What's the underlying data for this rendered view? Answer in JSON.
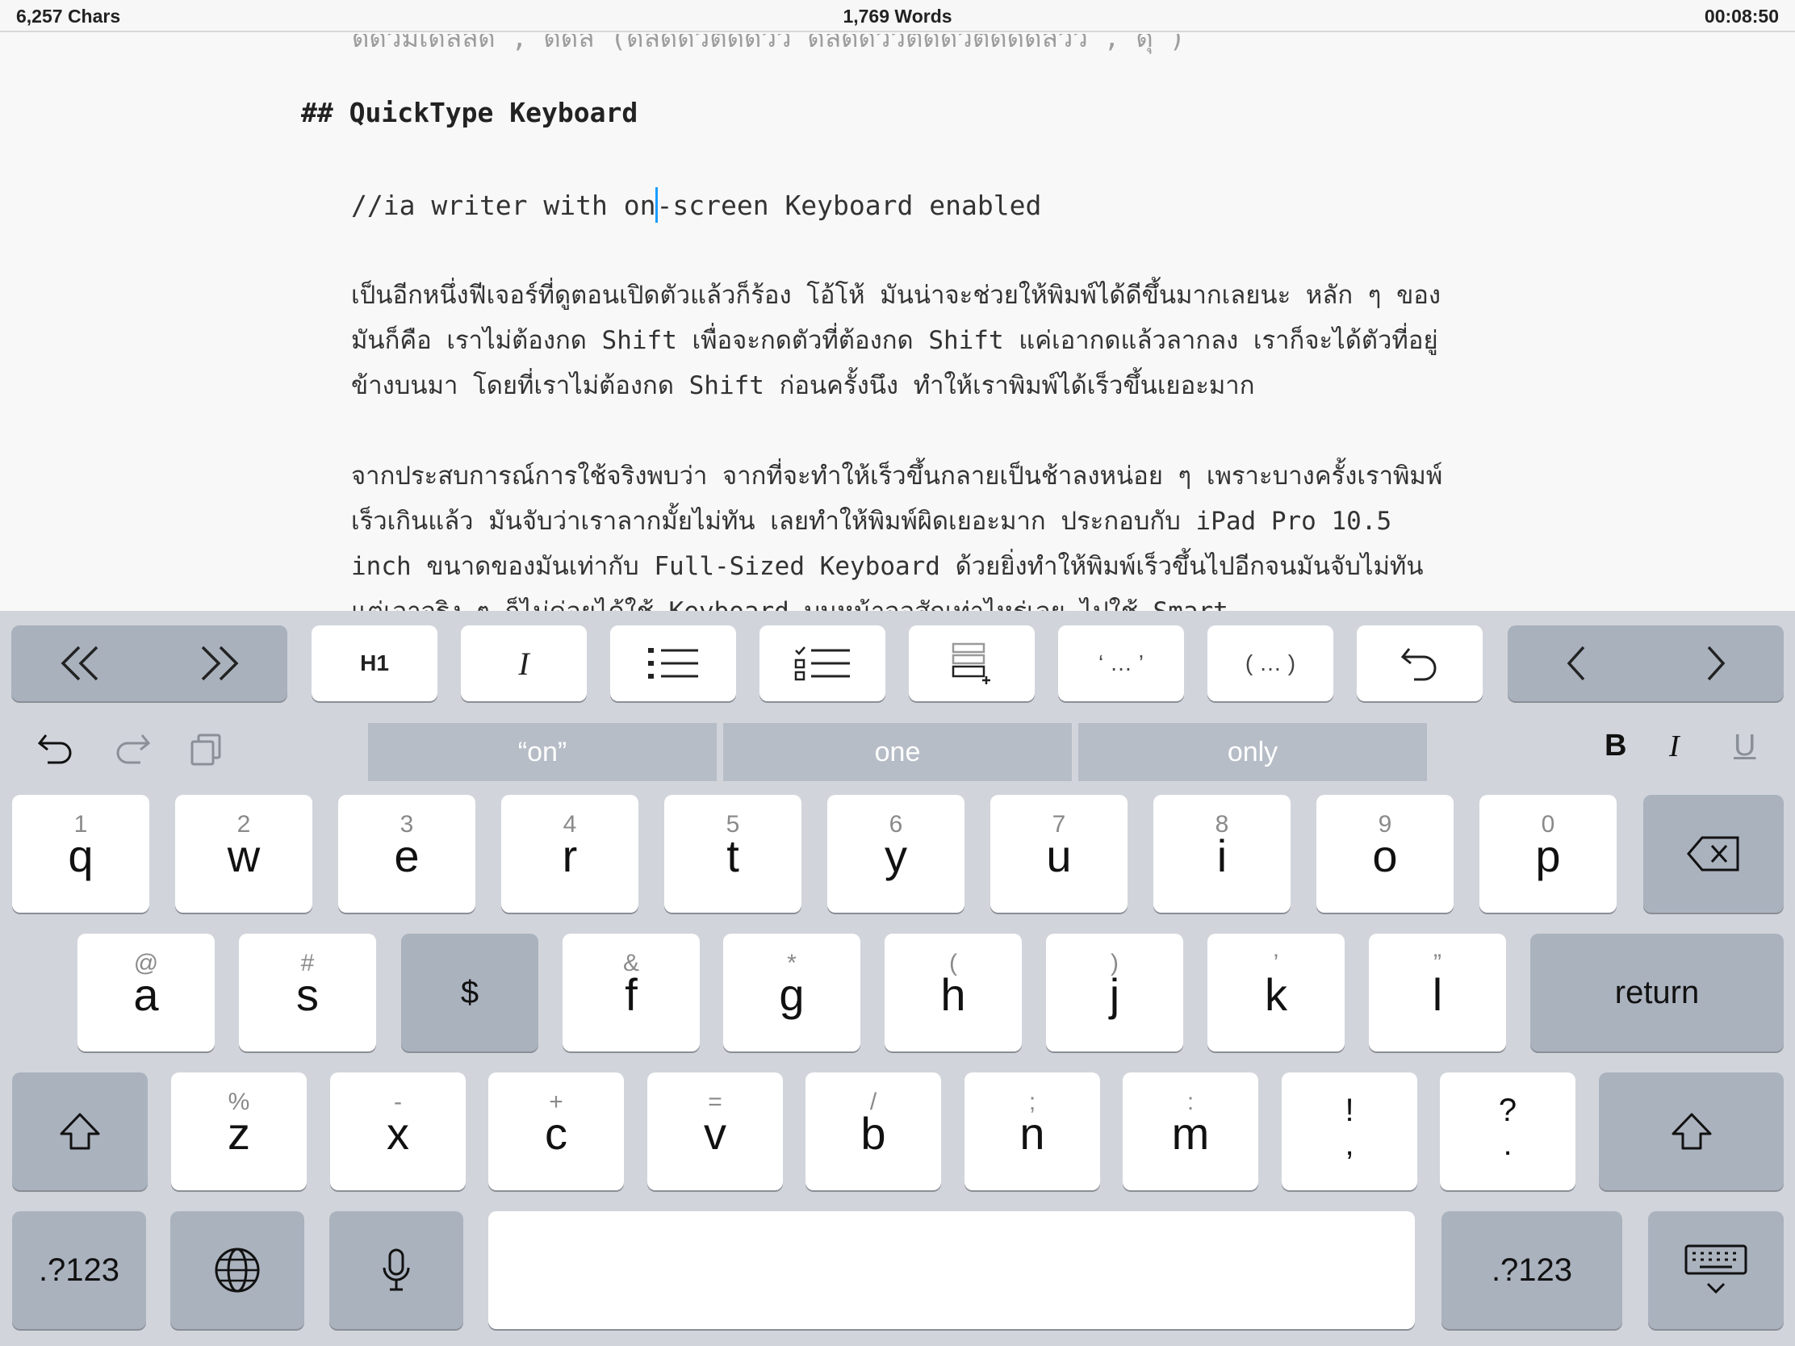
{
  "status": {
    "chars": "6,257 Chars",
    "words": "1,769 Words",
    "timer": "00:08:50"
  },
  "editor": {
    "faded_line": "ดดวิมิเดลลด , ดดลิ (ดลดดวิตดดวว ดลดดววิตดดวิตดดดลวว , ดุ )",
    "heading": "## QuickType Keyboard",
    "comment_before_cursor": "//ia writer with on",
    "comment_after_cursor": "-screen Keyboard enabled",
    "paragraph1": "เป็นอีกหนึ่งฟีเจอร์ที่ดูตอนเปิดตัวแล้วก็ร้อง โอ้โห้ มันน่าจะช่วยให้พิมพ์ได้ดีขึ้นมากเลยนะ หลัก ๆ ของมันก็คือ เราไม่ต้องกด Shift เพื่อจะกดตัวที่ต้องกด Shift แค่เอากดแล้วลากลง เราก็จะได้ตัวที่อยู่ข้างบนมา โดยที่เราไม่ต้องกด Shift ก่อนครั้งนึง ทำให้เราพิมพ์ได้เร็วขึ้นเยอะมาก",
    "paragraph2": "จากประสบการณ์การใช้จริงพบว่า จากที่จะทำให้เร็วขึ้นกลายเป็นช้าลงหน่อย ๆ เพราะบางครั้งเราพิมพ์เร็วเกินแล้ว มันจับว่าเราลากมั้ยไม่ทัน เลยทำให้พิมพ์ผิดเยอะมาก ประกอบกับ iPad Pro 10.5 inch ขนาดของมันเท่ากับ Full-Sized Keyboard ด้วยยิ่งทำให้พิมพ์เร็วขึ้นไปอีกจนมันจับไม่ทัน แต่เอาจริง ๆ ก็ไม่ค่อยได้ใช้ Keyboard บนหน้าจอสักเท่าไหร่เลย ไปใช้ Smart"
  },
  "toolbar": {
    "h1_label": "H1",
    "italic_label": "I",
    "quote_label": "‘ … ’",
    "paren_label": "( … )"
  },
  "quicktype": {
    "suggestions": [
      "“on”",
      "one",
      "only"
    ],
    "bold": "B",
    "italic": "I",
    "underline": "U"
  },
  "keys": {
    "row1": [
      {
        "main": "q",
        "alt": "1"
      },
      {
        "main": "w",
        "alt": "2"
      },
      {
        "main": "e",
        "alt": "3"
      },
      {
        "main": "r",
        "alt": "4"
      },
      {
        "main": "t",
        "alt": "5"
      },
      {
        "main": "y",
        "alt": "6"
      },
      {
        "main": "u",
        "alt": "7"
      },
      {
        "main": "i",
        "alt": "8"
      },
      {
        "main": "o",
        "alt": "9"
      },
      {
        "main": "p",
        "alt": "0"
      }
    ],
    "row2": [
      {
        "main": "a",
        "alt": "@"
      },
      {
        "main": "s",
        "alt": "#"
      },
      {
        "main": "$",
        "alt": ""
      },
      {
        "main": "f",
        "alt": "&"
      },
      {
        "main": "g",
        "alt": "*"
      },
      {
        "main": "h",
        "alt": "("
      },
      {
        "main": "j",
        "alt": ")"
      },
      {
        "main": "k",
        "alt": "’"
      },
      {
        "main": "l",
        "alt": "”"
      }
    ],
    "row3": [
      {
        "main": "z",
        "alt": "%"
      },
      {
        "main": "x",
        "alt": "-"
      },
      {
        "main": "c",
        "alt": "+"
      },
      {
        "main": "v",
        "alt": "="
      },
      {
        "main": "b",
        "alt": "/"
      },
      {
        "main": "n",
        "alt": ";"
      },
      {
        "main": "m",
        "alt": ":"
      }
    ],
    "exclaim_top": "!",
    "exclaim_bottom": ",",
    "question_top": "?",
    "question_bottom": ".",
    "return_label": "return",
    "numbers_label": ".?123",
    "numbers_label_right": ".?123"
  }
}
